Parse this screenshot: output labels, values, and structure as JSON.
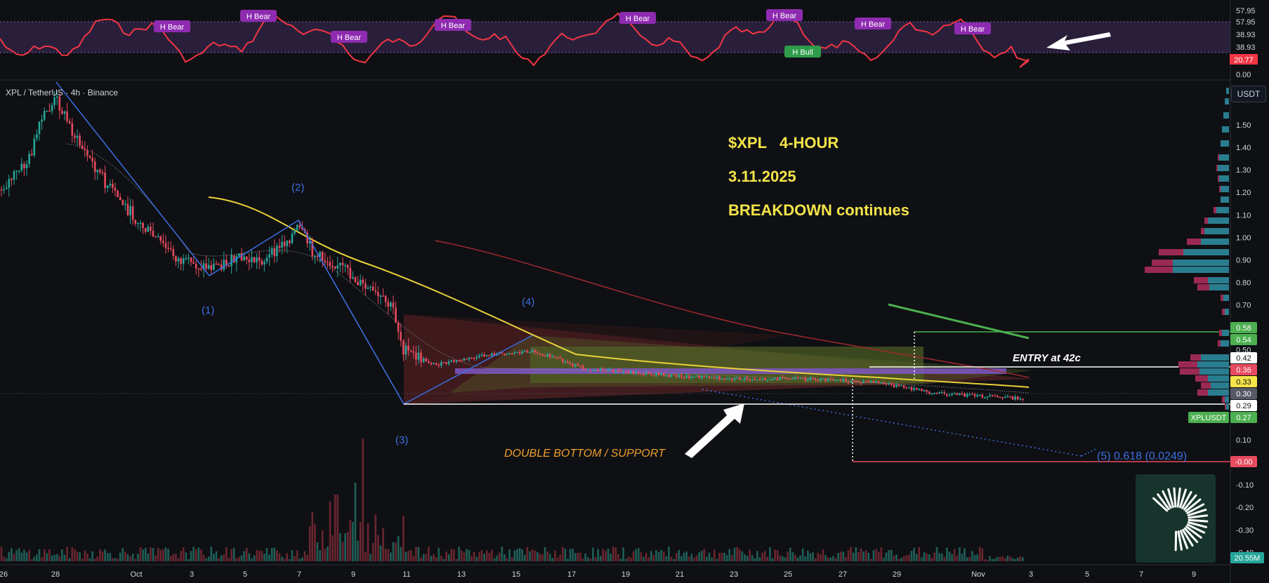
{
  "header": {
    "symbol_line": "XPL / TetherUS · 4h · Binance",
    "unit_button": "USDT"
  },
  "annotations": {
    "title_line1": "$XPL   4-HOUR",
    "title_line2": "3.11.2025",
    "title_line3": "BREAKDOWN continues",
    "entry": "ENTRY at 42c",
    "support": "DOUBLE BOTTOM / SUPPORT",
    "fib": "(5) 0.618 (0.0249)",
    "waves": [
      "(1)",
      "(2)",
      "(3)",
      "(4)"
    ]
  },
  "colors": {
    "accent_yellow": "#f5e44a",
    "bear": "#e84a5f",
    "bull": "#26a69a",
    "wave": "#3b6fe0",
    "rsi": "#f23645",
    "ma_yellow": "#e9d23a"
  },
  "chart_data": [
    {
      "type": "line",
      "name": "rsi-panel",
      "y_axis_labels": [
        "57.95",
        "57.95",
        "38.93",
        "38.93",
        "20.77",
        "0.00"
      ],
      "current_value": "20.77",
      "divergence_labels": [
        "H Bear",
        "H Bear",
        "H Bear",
        "H Bear",
        "H Bear",
        "H Bear",
        "H Bull",
        "H Bear",
        "H Bear"
      ]
    },
    {
      "type": "candlestick",
      "name": "price-panel",
      "x_tick_labels": [
        "26",
        "28",
        "Oct",
        "3",
        "5",
        "7",
        "9",
        "11",
        "13",
        "15",
        "17",
        "19",
        "21",
        "23",
        "25",
        "27",
        "29",
        "Nov",
        "3",
        "5",
        "7",
        "9"
      ],
      "y_tick_labels": [
        "1.50",
        "1.40",
        "1.30",
        "1.20",
        "1.10",
        "1.00",
        "0.90",
        "0.80",
        "0.70",
        "0.50",
        "0.25",
        "0.10",
        "-0.10",
        "-0.20",
        "-0.30",
        "-0.40"
      ],
      "price_tags": [
        {
          "label": "0.58",
          "color": "#4caf50"
        },
        {
          "label": "0.54",
          "color": "#4caf50"
        },
        {
          "label": "0.42",
          "color": "#ffffff"
        },
        {
          "label": "0.36",
          "color": "#e84a5f"
        },
        {
          "label": "0.33",
          "color": "#f5e44a"
        },
        {
          "label": "0.30",
          "color": "#555a66"
        },
        {
          "label": "0.29",
          "color": "#ffffff"
        },
        {
          "label": "0.27",
          "color": "#4caf50"
        },
        {
          "label": "-0.00",
          "color": "#e84a5f"
        }
      ],
      "symbol_tag": "XPLUSDT",
      "volume_tag": "20.55M",
      "key_levels": {
        "entry": 0.42,
        "support": 0.29,
        "target": 0.0249,
        "tp": 0.58
      },
      "wave_points": [
        {
          "label": "(1)",
          "price": 0.83
        },
        {
          "label": "(2)",
          "price": 1.07
        },
        {
          "label": "(3)",
          "price": 0.29
        },
        {
          "label": "(4)",
          "price": 0.55
        }
      ]
    }
  ]
}
